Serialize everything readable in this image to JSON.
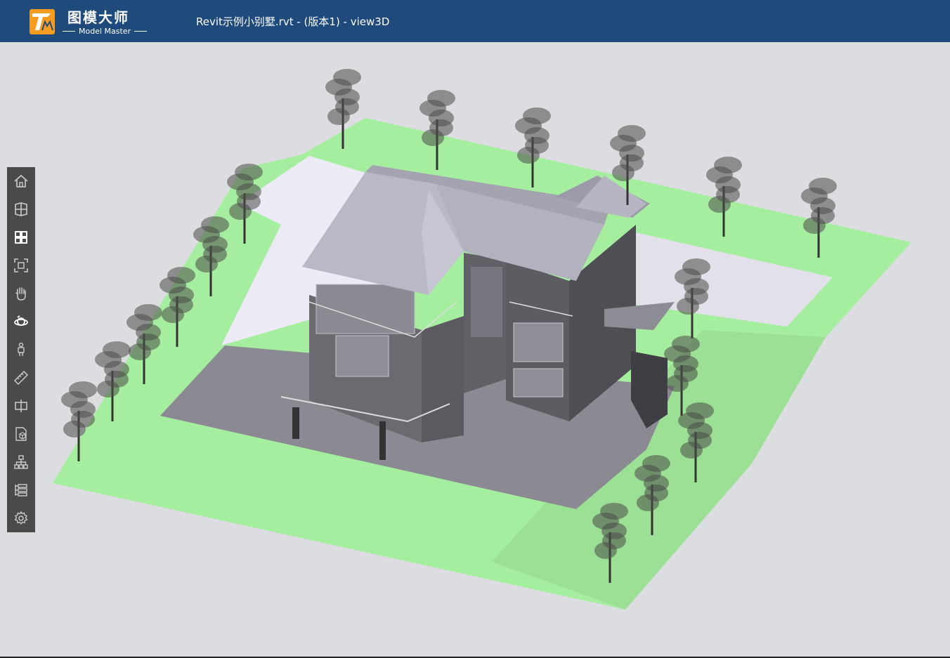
{
  "header": {
    "brand_cn": "图模大师",
    "brand_en": "Model Master",
    "document_title": "Revit示例小别墅.rvt - (版本1) - view3D",
    "background_color": "#1f4a7c",
    "logo_color": "#f39c1f"
  },
  "toolbar": {
    "items": [
      {
        "name": "home-view-icon"
      },
      {
        "name": "view-cube-icon"
      },
      {
        "name": "grid-views-icon"
      },
      {
        "name": "fit-frame-icon"
      },
      {
        "name": "pan-hand-icon"
      },
      {
        "name": "orbit-icon"
      },
      {
        "name": "walk-person-icon"
      },
      {
        "name": "measure-ruler-icon"
      },
      {
        "name": "section-box-icon"
      },
      {
        "name": "model-properties-icon"
      },
      {
        "name": "structure-tree-icon"
      },
      {
        "name": "list-icon"
      },
      {
        "name": "settings-gear-icon"
      }
    ]
  },
  "viewport": {
    "background_color": "#dcdde0",
    "grass_color": "#a6ee9f",
    "paving_color": "#8b8a92",
    "roof_color": "#a9a9b6"
  }
}
